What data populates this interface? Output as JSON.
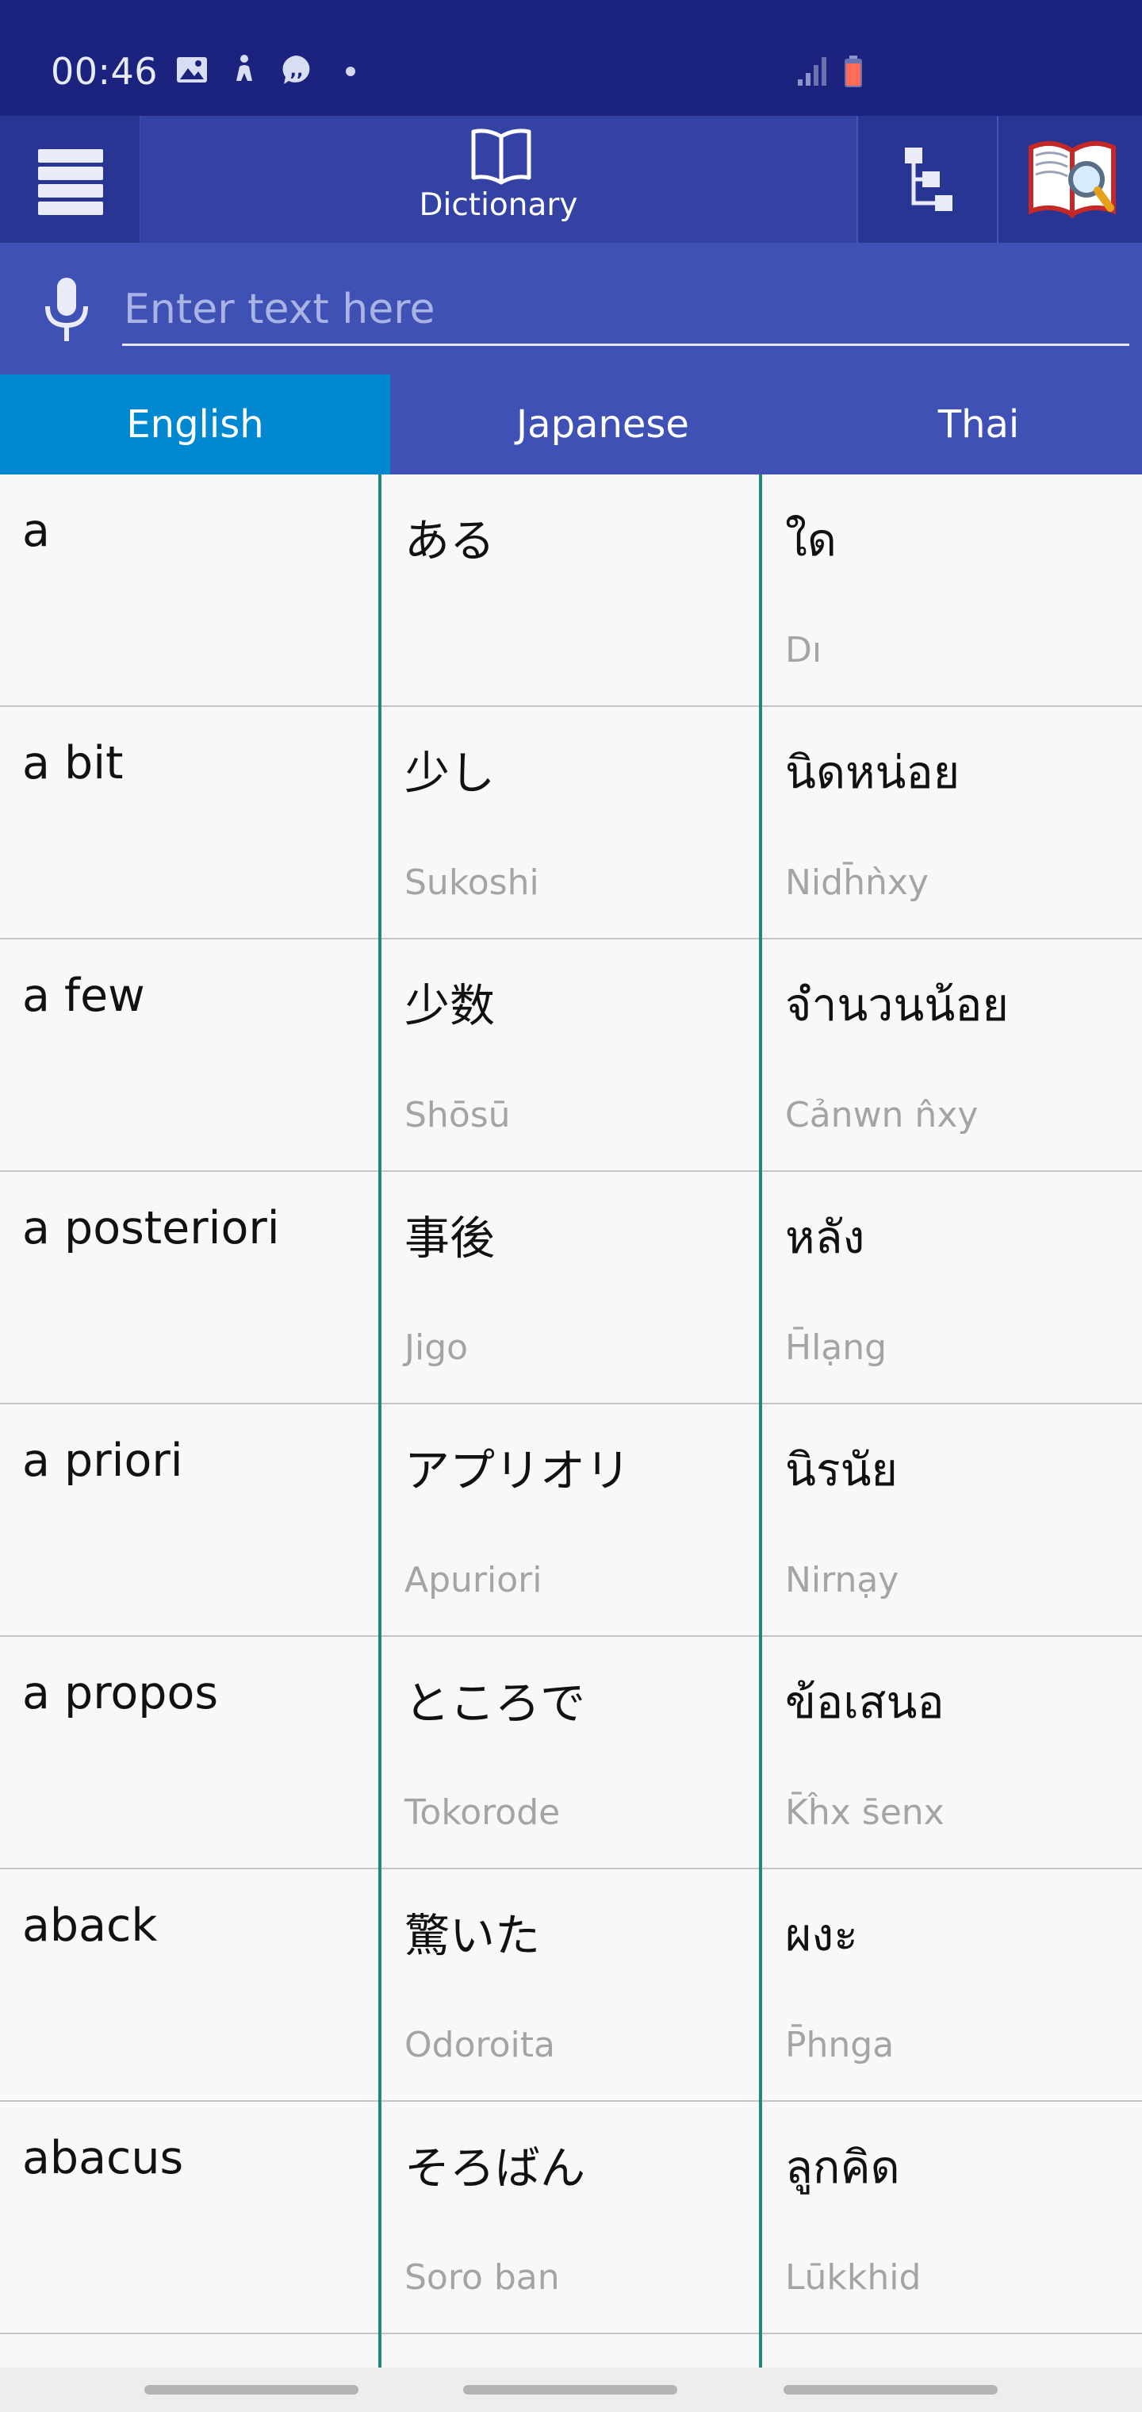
{
  "status_bar": {
    "time": "00:46",
    "icons": [
      "image-icon",
      "accessibility-icon",
      "chat-bubble-icon",
      "notification-dot-icon",
      "signal-icon",
      "battery-icon"
    ]
  },
  "app_bar": {
    "dictionary_label": "Dictionary",
    "icons": [
      "menu-icon",
      "book-icon",
      "tree-structure-icon",
      "search-book-icon"
    ]
  },
  "search": {
    "placeholder": "Enter text here",
    "value": ""
  },
  "languages": {
    "columns": [
      "English",
      "Japanese",
      "Thai"
    ],
    "active": "English"
  },
  "colors": {
    "status_bar": "#1b237e",
    "app_bar": "#283593",
    "search_row": "#3f51b5",
    "active_language": "#0288d1",
    "column_divider": "#1a8a7f"
  },
  "rows": [
    {
      "english": "a",
      "japanese": "ある",
      "japanese_romanized": "",
      "thai": "ใด",
      "thai_romanized": "Dı"
    },
    {
      "english": "a bit",
      "japanese": "少し",
      "japanese_romanized": "Sukoshi",
      "thai": "นิดหน่อย",
      "thai_romanized": "Nidh̄ǹxy"
    },
    {
      "english": "a few",
      "japanese": "少数",
      "japanese_romanized": "Shōsū",
      "thai": "จำนวนน้อย",
      "thai_romanized": "Cảnwn n̂xy"
    },
    {
      "english": "a posteriori",
      "japanese": "事後",
      "japanese_romanized": "Jigo",
      "thai": "หลัง",
      "thai_romanized": "H̄lạng"
    },
    {
      "english": "a priori",
      "japanese": "アプリオリ",
      "japanese_romanized": "Apuriori",
      "thai": "นิรนัย",
      "thai_romanized": "Nirnạy"
    },
    {
      "english": "a propos",
      "japanese": "ところで",
      "japanese_romanized": "Tokorode",
      "thai": "ข้อเสนอ",
      "thai_romanized": "K̄ĥx s̄enx"
    },
    {
      "english": "aback",
      "japanese": "驚いた",
      "japanese_romanized": "Odoroita",
      "thai": "ผงะ",
      "thai_romanized": "P̄hnga"
    },
    {
      "english": "abacus",
      "japanese": "そろばん",
      "japanese_romanized": "Soro ban",
      "thai": "ลูกคิด",
      "thai_romanized": "Lūkkhid"
    }
  ]
}
